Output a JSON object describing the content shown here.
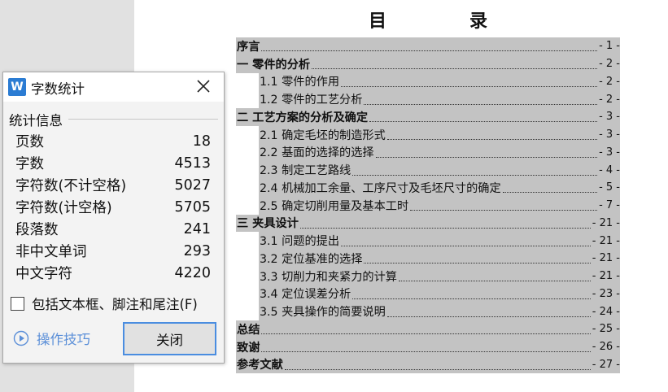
{
  "document": {
    "toc_title": "目　录",
    "entries": [
      {
        "level": 1,
        "text": "序言",
        "page": "- 1 -"
      },
      {
        "level": 1,
        "text": "一 零件的分析",
        "page": "- 2 -"
      },
      {
        "level": 2,
        "text": "1.1 零件的作用",
        "page": "- 2 -"
      },
      {
        "level": 2,
        "text": "1.2  零件的工艺分析",
        "page": "- 2 -"
      },
      {
        "level": 1,
        "text": "二 工艺方案的分析及确定",
        "page": "- 3 -"
      },
      {
        "level": 2,
        "text": "2.1 确定毛坯的制造形式",
        "page": "- 3 -"
      },
      {
        "level": 2,
        "text": "2.2 基面的选择的选择",
        "page": "- 3 -"
      },
      {
        "level": 2,
        "text": "2.3 制定工艺路线",
        "page": "- 4 -"
      },
      {
        "level": 2,
        "text": "2.4 机械加工余量、工序尺寸及毛坯尺寸的确定",
        "page": "- 5 -"
      },
      {
        "level": 2,
        "text": "2.5 确定切削用量及基本工时",
        "page": "- 7 -"
      },
      {
        "level": 1,
        "text": "三 夹具设计",
        "page": "- 21 -"
      },
      {
        "level": 2,
        "text": "3.1 问题的提出",
        "page": "- 21 -"
      },
      {
        "level": 2,
        "text": "3.2 定位基准的选择",
        "page": "- 21 -"
      },
      {
        "level": 2,
        "text": "3.3 切削力和夹紧力的计算",
        "page": "- 21 -"
      },
      {
        "level": 2,
        "text": "3.4 定位误差分析",
        "page": "- 23 -"
      },
      {
        "level": 2,
        "text": "3.5 夹具操作的简要说明",
        "page": "- 24 -"
      },
      {
        "level": 1,
        "text": "总结",
        "page": "- 25 -"
      },
      {
        "level": 1,
        "text": "致谢",
        "page": "- 26 -"
      },
      {
        "level": 1,
        "text": "参考文献",
        "page": "- 27 -"
      }
    ]
  },
  "dialog": {
    "app_icon_letter": "W",
    "title": "字数统计",
    "section_label": "统计信息",
    "stats": [
      {
        "label": "页数",
        "value": "18"
      },
      {
        "label": "字数",
        "value": "4513"
      },
      {
        "label": "字符数(不计空格)",
        "value": "5027"
      },
      {
        "label": "字符数(计空格)",
        "value": "5705"
      },
      {
        "label": "段落数",
        "value": "241"
      },
      {
        "label": "非中文单词",
        "value": "293"
      },
      {
        "label": "中文字符",
        "value": "4220"
      }
    ],
    "checkbox_label": "包括文本框、脚注和尾注(F)",
    "checkbox_checked": false,
    "tips_label": "操作技巧",
    "close_button_label": "关闭",
    "accent_color": "#4a8de0",
    "icon_color": "#2b7cd3"
  }
}
